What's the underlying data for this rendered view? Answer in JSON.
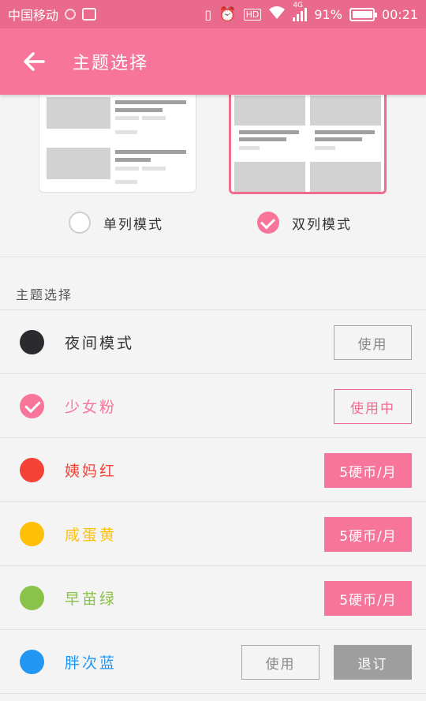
{
  "status_bar": {
    "carrier": "中国移动",
    "network": "4G",
    "battery": "91%",
    "time": "00:21"
  },
  "app_bar": {
    "title": "主题选择"
  },
  "layout_modes": {
    "single_label": "单列模式",
    "double_label": "双列模式",
    "selected": "double"
  },
  "themes_section": {
    "title": "主题选择",
    "items": [
      {
        "name": "夜间模式",
        "color": "#2b2a2f",
        "button": "使用",
        "button_style": "outline"
      },
      {
        "name": "少女粉",
        "color": "#f7759a",
        "button": "使用中",
        "button_style": "outline-pink",
        "active": true
      },
      {
        "name": "姨妈红",
        "color": "#f44336",
        "button": "5硬币/月",
        "button_style": "pink"
      },
      {
        "name": "咸蛋黄",
        "color": "#ffc107",
        "button": "5硬币/月",
        "button_style": "pink"
      },
      {
        "name": "早苗绿",
        "color": "#8bc34a",
        "button": "5硬币/月",
        "button_style": "pink"
      },
      {
        "name": "胖次蓝",
        "color": "#2196f3",
        "button": "使用",
        "button_style": "outline",
        "extra_button": "退订"
      }
    ]
  },
  "colors": {
    "accent": "#f7759a",
    "status_bar": "#e96a8c"
  }
}
